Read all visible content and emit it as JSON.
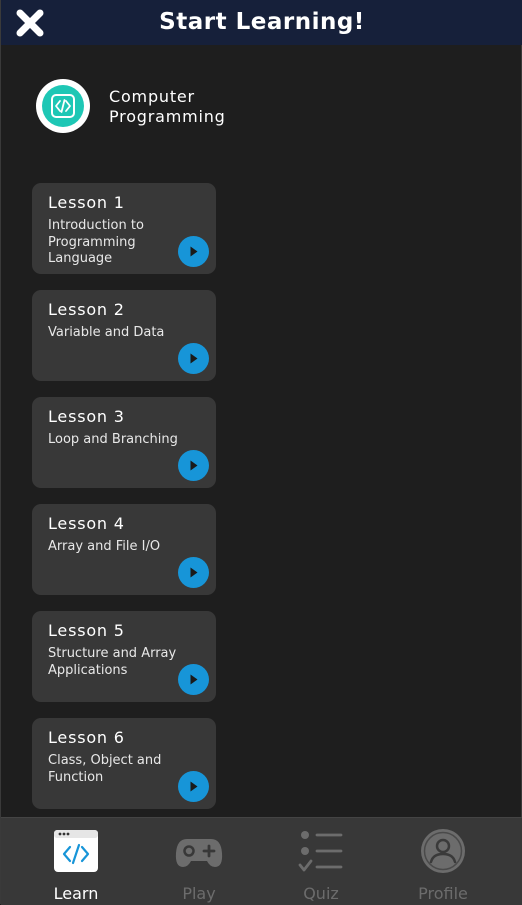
{
  "header": {
    "title": "Start Learning!"
  },
  "course": {
    "title": "Computer\nProgramming"
  },
  "lessons": [
    {
      "title": "Lesson 1",
      "desc": "Introduction to Programming Language"
    },
    {
      "title": "Lesson 2",
      "desc": "Variable and Data"
    },
    {
      "title": "Lesson 3",
      "desc": "Loop and Branching"
    },
    {
      "title": "Lesson 4",
      "desc": "Array and File I/O"
    },
    {
      "title": "Lesson 5",
      "desc": "Structure and Array Applications"
    },
    {
      "title": "Lesson 6",
      "desc": "Class, Object and Function"
    }
  ],
  "nav": [
    {
      "label": "Learn",
      "icon": "code-window-icon",
      "active": true
    },
    {
      "label": "Play",
      "icon": "gamepad-icon",
      "active": false
    },
    {
      "label": "Quiz",
      "icon": "checklist-icon",
      "active": false
    },
    {
      "label": "Profile",
      "icon": "profile-icon",
      "active": false
    }
  ],
  "colors": {
    "header_bg": "#16203a",
    "background": "#1e1e1e",
    "card_bg": "#383838",
    "play_button": "#1795d8",
    "course_icon": "#1ec7b5",
    "nav_bg": "#383838",
    "nav_inactive": "#6c6c6c"
  }
}
